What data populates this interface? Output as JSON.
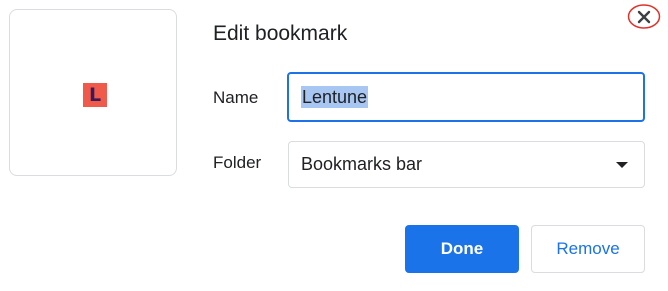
{
  "dialog": {
    "title": "Edit bookmark",
    "close_icon": "close-icon",
    "favicon_letter": "L",
    "favicon_bg": "#ef5a4b",
    "favicon_fg": "#3b1a5a"
  },
  "form": {
    "name_label": "Name",
    "name_value": "Lentune",
    "folder_label": "Folder",
    "folder_value": "Bookmarks bar"
  },
  "actions": {
    "done_label": "Done",
    "remove_label": "Remove"
  },
  "colors": {
    "accent": "#1a73e8",
    "close_highlight": "#e0322b"
  }
}
